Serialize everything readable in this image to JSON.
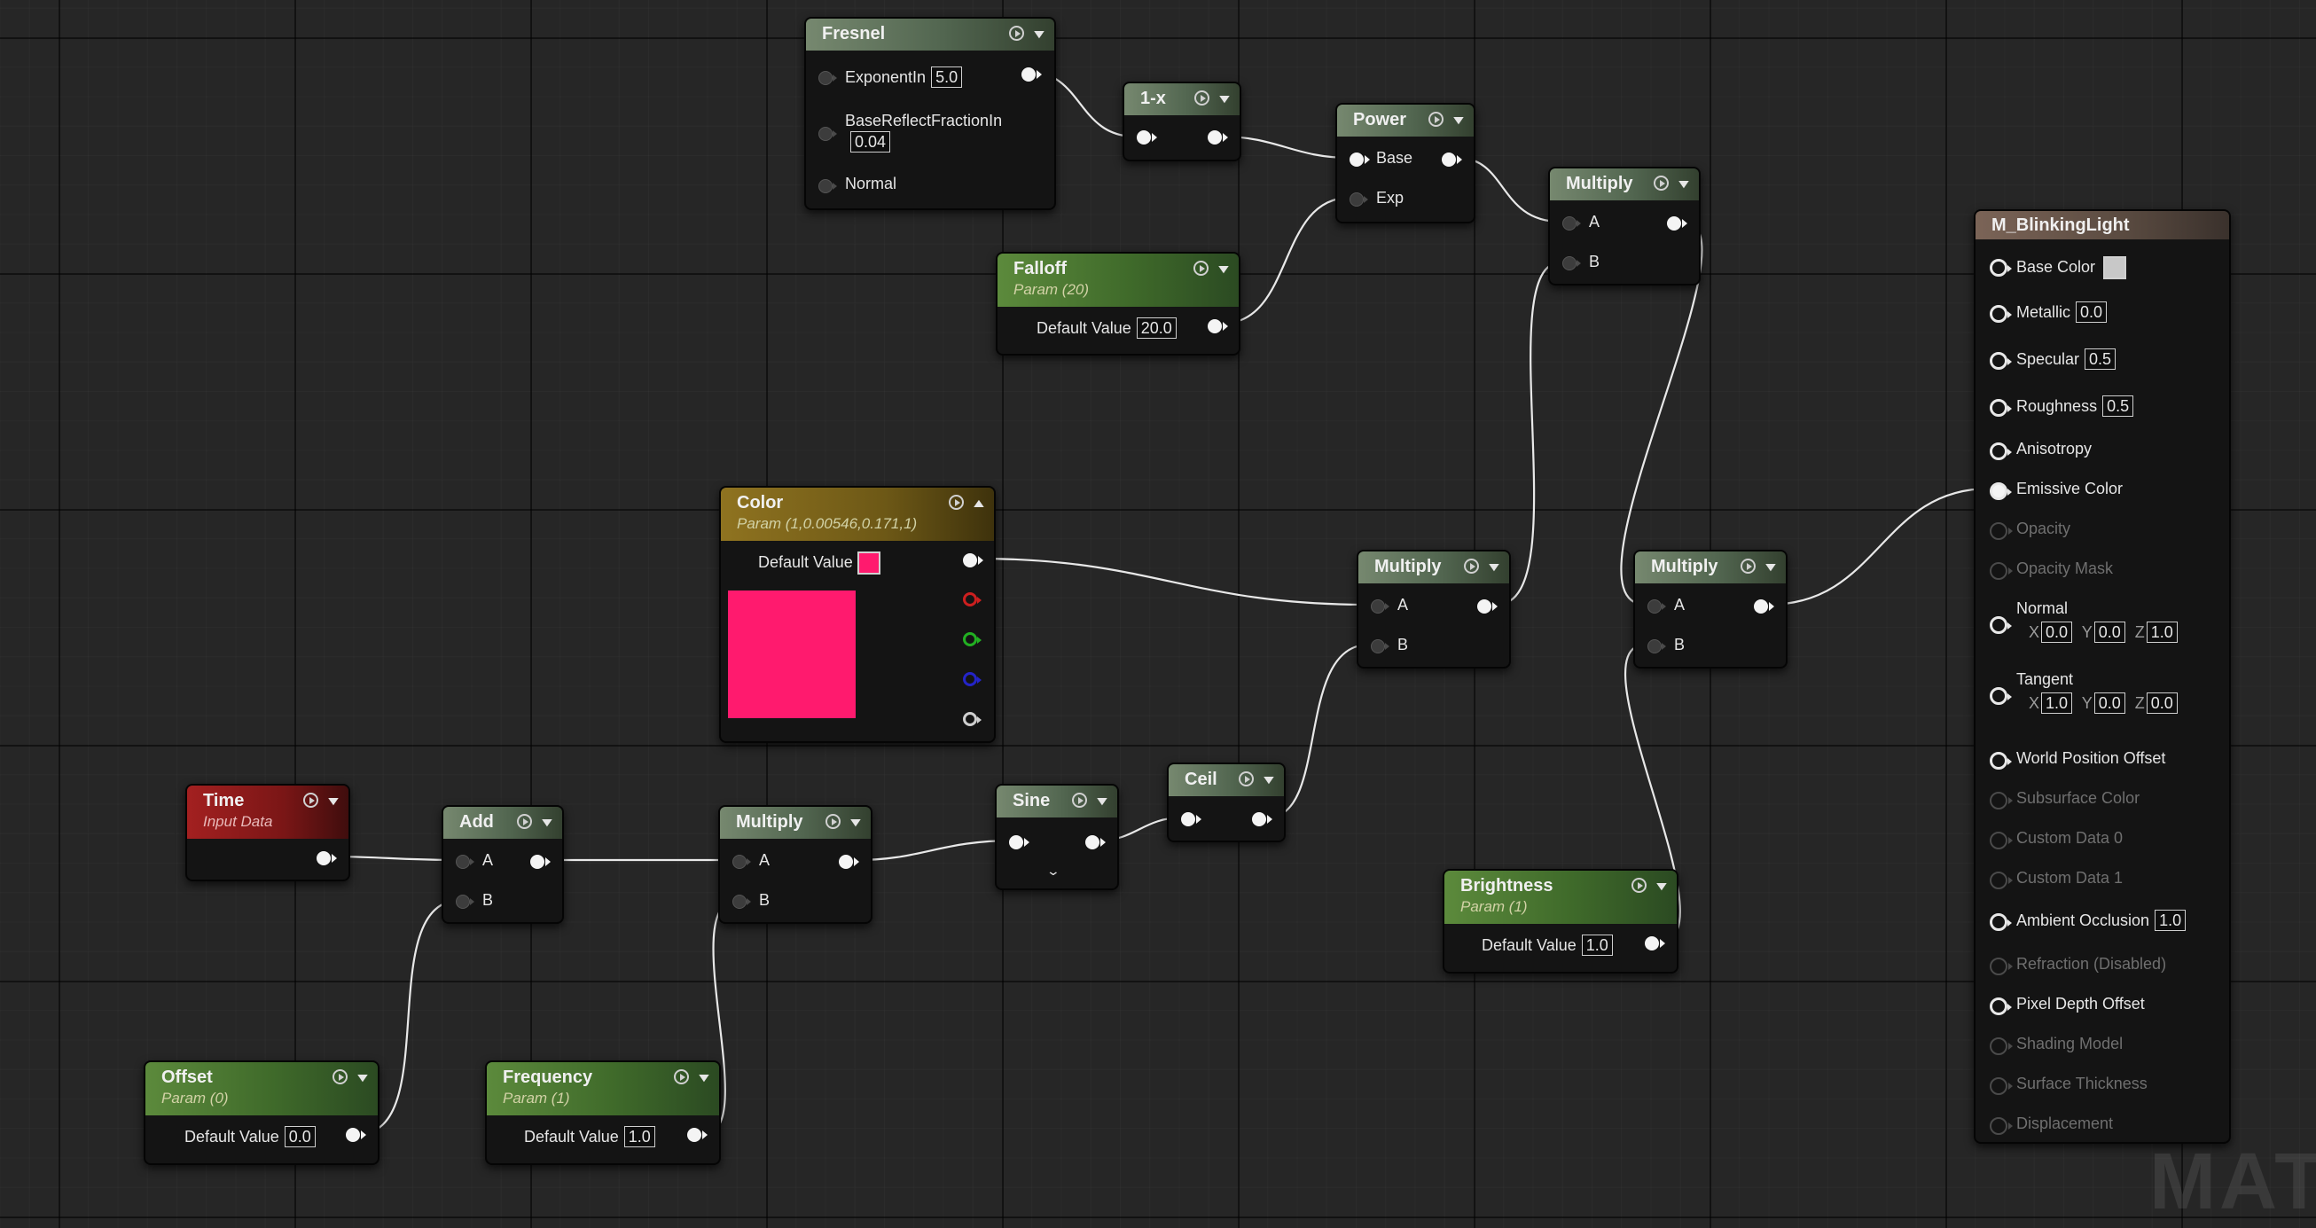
{
  "nodes": {
    "fresnel": {
      "title": "Fresnel",
      "pins": {
        "exponent_in": "ExponentIn",
        "exponent_in_value": "5.0",
        "base_reflect": "BaseReflectFractionIn",
        "base_reflect_value": "0.04",
        "normal": "Normal"
      }
    },
    "one_minus": {
      "title": "1-x"
    },
    "power": {
      "title": "Power",
      "pins": {
        "base": "Base",
        "exp": "Exp"
      }
    },
    "falloff": {
      "title": "Falloff",
      "subtitle": "Param (20)",
      "label": "Default Value",
      "value": "20.0"
    },
    "multiply_top": {
      "title": "Multiply",
      "pins": {
        "a": "A",
        "b": "B"
      }
    },
    "color": {
      "title": "Color",
      "subtitle": "Param (1,0.00546,0.171,1)",
      "label": "Default Value",
      "swatch_color": "#ff1a6e"
    },
    "multiply_mid": {
      "title": "Multiply",
      "pins": {
        "a": "A",
        "b": "B"
      }
    },
    "multiply_right": {
      "title": "Multiply",
      "pins": {
        "a": "A",
        "b": "B"
      }
    },
    "time": {
      "title": "Time",
      "subtitle": "Input Data"
    },
    "add": {
      "title": "Add",
      "pins": {
        "a": "A",
        "b": "B"
      }
    },
    "multiply_low": {
      "title": "Multiply",
      "pins": {
        "a": "A",
        "b": "B"
      }
    },
    "sine": {
      "title": "Sine"
    },
    "ceil": {
      "title": "Ceil"
    },
    "brightness": {
      "title": "Brightness",
      "subtitle": "Param (1)",
      "label": "Default Value",
      "value": "1.0"
    },
    "offset": {
      "title": "Offset",
      "subtitle": "Param (0)",
      "label": "Default Value",
      "value": "0.0"
    },
    "frequency": {
      "title": "Frequency",
      "subtitle": "Param (1)",
      "label": "Default Value",
      "value": "1.0"
    }
  },
  "material": {
    "title": "M_BlinkingLight",
    "base_color": {
      "label": "Base Color",
      "swatch": "#c8c8c8"
    },
    "metallic": {
      "label": "Metallic",
      "value": "0.0"
    },
    "specular": {
      "label": "Specular",
      "value": "0.5"
    },
    "roughness": {
      "label": "Roughness",
      "value": "0.5"
    },
    "anisotropy": "Anisotropy",
    "emissive": "Emissive Color",
    "opacity": "Opacity",
    "opacity_mask": "Opacity Mask",
    "normal": {
      "label": "Normal",
      "x": "0.0",
      "y": "0.0",
      "z": "1.0"
    },
    "tangent": {
      "label": "Tangent",
      "x": "1.0",
      "y": "0.0",
      "z": "0.0"
    },
    "axis_labels": {
      "x": "X",
      "y": "Y",
      "z": "Z"
    },
    "world_position_offset": "World Position Offset",
    "subsurface_color": "Subsurface Color",
    "custom_data_0": "Custom Data 0",
    "custom_data_1": "Custom Data 1",
    "ambient_occlusion": {
      "label": "Ambient Occlusion",
      "value": "1.0"
    },
    "refraction": "Refraction (Disabled)",
    "pixel_depth_offset": "Pixel Depth Offset",
    "shading_model": "Shading Model",
    "surface_thickness": "Surface Thickness",
    "displacement": "Displacement"
  },
  "watermark": "MATE",
  "colors": {
    "wire": "#e8e8e8",
    "pin_red": "#cc1f1f",
    "pin_green": "#22b022",
    "pin_blue": "#2424c8",
    "pin_alpha": "#cfcfcf"
  }
}
